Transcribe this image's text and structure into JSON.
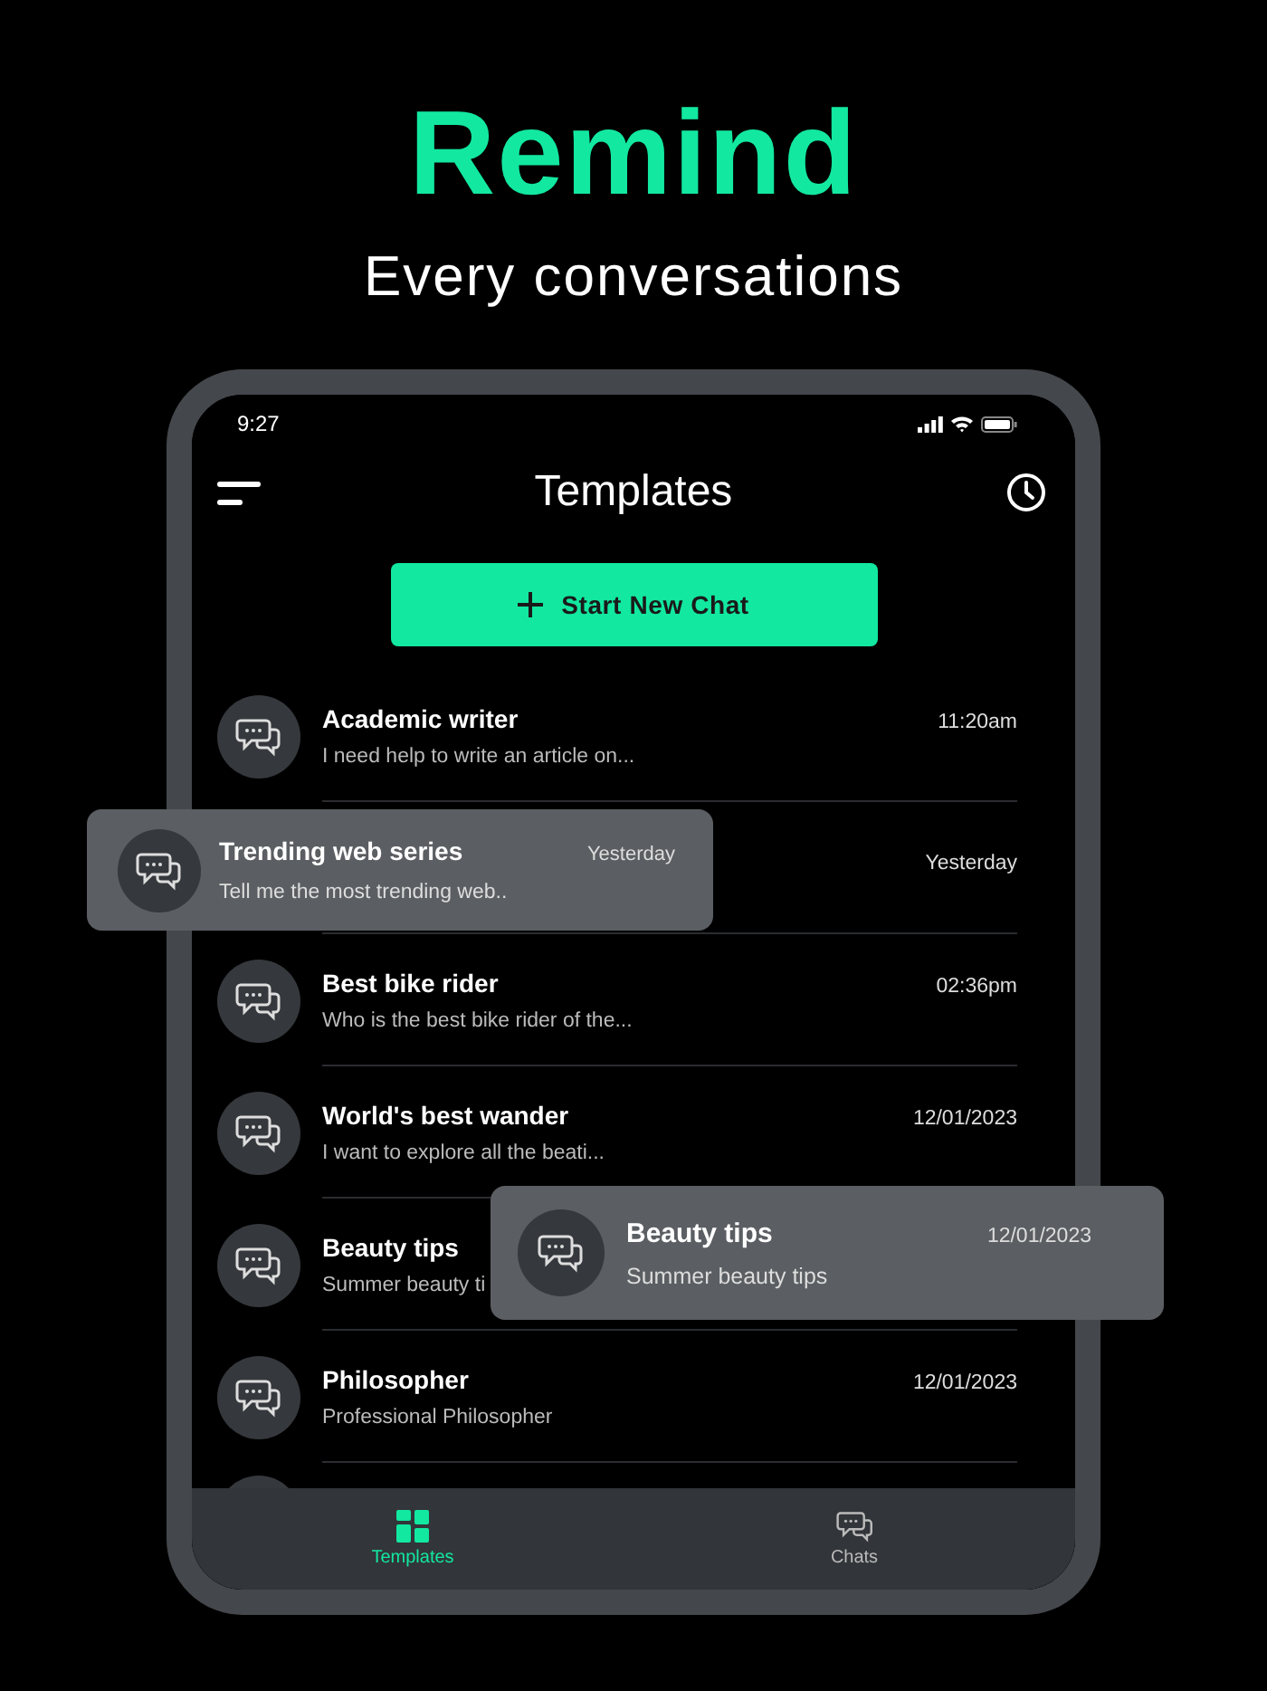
{
  "hero": {
    "title": "Remind",
    "subtitle": "Every conversations"
  },
  "status_bar": {
    "time": "9:27"
  },
  "header": {
    "title": "Templates"
  },
  "primary_button": {
    "label": "Start New Chat"
  },
  "chats": [
    {
      "title": "Academic writer",
      "preview": "I need help to write an article on...",
      "time": "11:20am"
    },
    {
      "time": "Yesterday"
    },
    {
      "title": "Best bike rider",
      "preview": "Who is the best bike rider of the...",
      "time": "02:36pm"
    },
    {
      "title": "World's best wander",
      "preview": "I want to explore all the beati...",
      "time": "12/01/2023"
    },
    {
      "title": "Beauty tips",
      "preview": "Summer beauty ti"
    },
    {
      "title": "Philosopher",
      "preview": "Professional Philosopher",
      "time": "12/01/2023"
    }
  ],
  "floating_cards": [
    {
      "title": "Trending web series",
      "preview": "Tell me the most trending web..",
      "time": "Yesterday"
    },
    {
      "title": "Beauty tips",
      "preview": "Summer beauty tips",
      "time": "12/01/2023"
    }
  ],
  "tabs": [
    {
      "kind": "grid",
      "label": "Templates",
      "selected": true
    },
    {
      "kind": "chat",
      "label": "Chats",
      "selected": false
    }
  ]
}
